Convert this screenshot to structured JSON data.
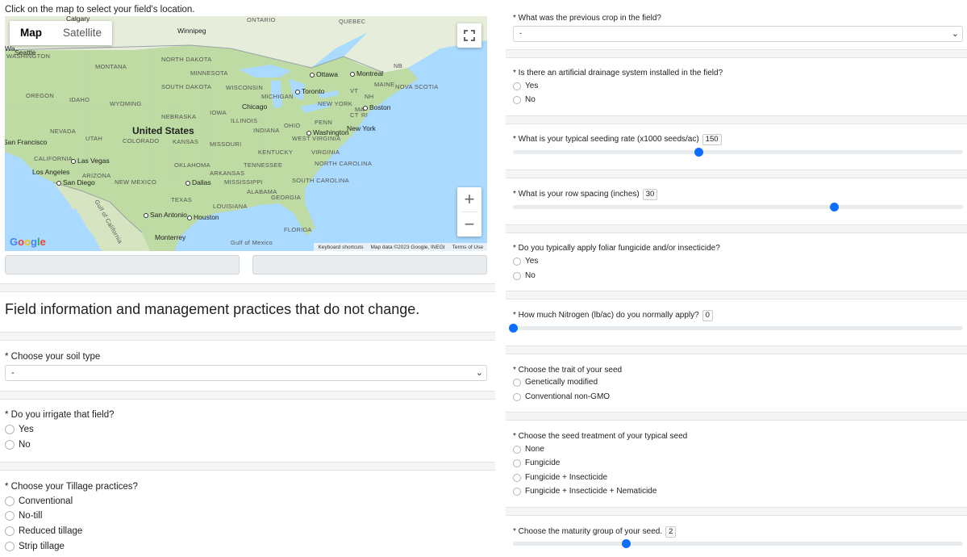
{
  "map": {
    "caption": "Click on the map to select your field's location.",
    "map_type": {
      "active": "Map",
      "inactive": "Satellite"
    },
    "zoom_in": "+",
    "zoom_out": "−",
    "labels": {
      "country": "United States",
      "regions": [
        "ONTARIO",
        "QUEBEC",
        "Calgary",
        "Wa",
        "MONTANA",
        "NORTH DAKOTA",
        "MINNESOTA",
        "SOUTH DAKOTA",
        "WISCONSIN",
        "MICHIGAN",
        "OREGON",
        "IDAHO",
        "WYOMING",
        "NEBRASKA",
        "IOWA",
        "ILLINOIS",
        "OHIO",
        "PENN",
        "NEVADA",
        "UTAH",
        "COLORADO",
        "KANSAS",
        "MISSOURI",
        "INDIANA",
        "WEST VIRGINIA",
        "KENTUCKY",
        "VIRGINIA",
        "CALIFORNIA",
        "ARIZONA",
        "NEW MEXICO",
        "OKLAHOMA",
        "ARKANSAS",
        "TENNESSEE",
        "NORTH CAROLINA",
        "SOUTH CAROLINA",
        "MISSISSIPPI",
        "ALABAMA",
        "GEORGIA",
        "TEXAS",
        "LOUISIANA",
        "FLORIDA",
        "NB",
        "MAINE",
        "NOVA SCOTIA",
        "VT",
        "NH",
        "MA",
        "CT",
        "RI",
        "NEW YORK",
        "WASHINGTON",
        "Gulf of Mexico",
        "Gulf of California"
      ],
      "cities": [
        "Winnipeg",
        "Seattle",
        "Ottawa",
        "Montreal",
        "Toronto",
        "Chicago",
        "Boston",
        "Washington",
        "New York",
        "San Francisco",
        "Las Vegas",
        "Los Angeles",
        "San Diego",
        "Dallas",
        "San Antonio",
        "Houston",
        "Monterrey"
      ]
    },
    "attribution": {
      "shortcuts": "Keyboard shortcuts",
      "data": "Map data ©2023 Google, INEGI",
      "terms": "Terms of Use"
    },
    "logo": "Google"
  },
  "section_title": "Field information and management practices that do not change.",
  "left_questions": {
    "soil": {
      "label": "* Choose your soil type",
      "value": "-"
    },
    "irrigate": {
      "label": "* Do you irrigate that field?",
      "options": [
        "Yes",
        "No"
      ]
    },
    "tillage": {
      "label": "* Choose your Tillage practices?",
      "options": [
        "Conventional",
        "No-till",
        "Reduced tillage",
        "Strip tillage"
      ]
    }
  },
  "right_questions": {
    "previous_crop": {
      "label": "* What was the previous crop in the field?",
      "value": "-"
    },
    "drainage": {
      "label": "* Is there an artificial drainage system installed in the field?",
      "options": [
        "Yes",
        "No"
      ]
    },
    "seeding_rate": {
      "label": "* What is your typical seeding rate (x1000 seeds/ac)",
      "value": "150",
      "fraction": 0.413
    },
    "row_spacing": {
      "label": "* What is your row spacing (inches)",
      "value": "30",
      "fraction": 0.714
    },
    "fungicide": {
      "label": "* Do you typically apply foliar fungicide and/or insecticide?",
      "options": [
        "Yes",
        "No"
      ]
    },
    "nitrogen": {
      "label": "* How much Nitrogen (lb/ac) do you normally apply?",
      "value": "0",
      "fraction": 0.0
    },
    "trait": {
      "label": "* Choose the trait of your seed",
      "options": [
        "Genetically modified",
        "Conventional non-GMO"
      ]
    },
    "treatment": {
      "label": "* Choose the seed treatment of your typical seed",
      "options": [
        "None",
        "Fungicide",
        "Fungicide + Insecticide",
        "Fungicide + Insecticide + Nematicide"
      ]
    },
    "maturity": {
      "label": "* Choose the maturity group of your seed.",
      "value": "2",
      "fraction": 0.25
    }
  },
  "colors": {
    "accent": "#0d6efd",
    "water": "#aadaff",
    "land": "#bddba2"
  }
}
